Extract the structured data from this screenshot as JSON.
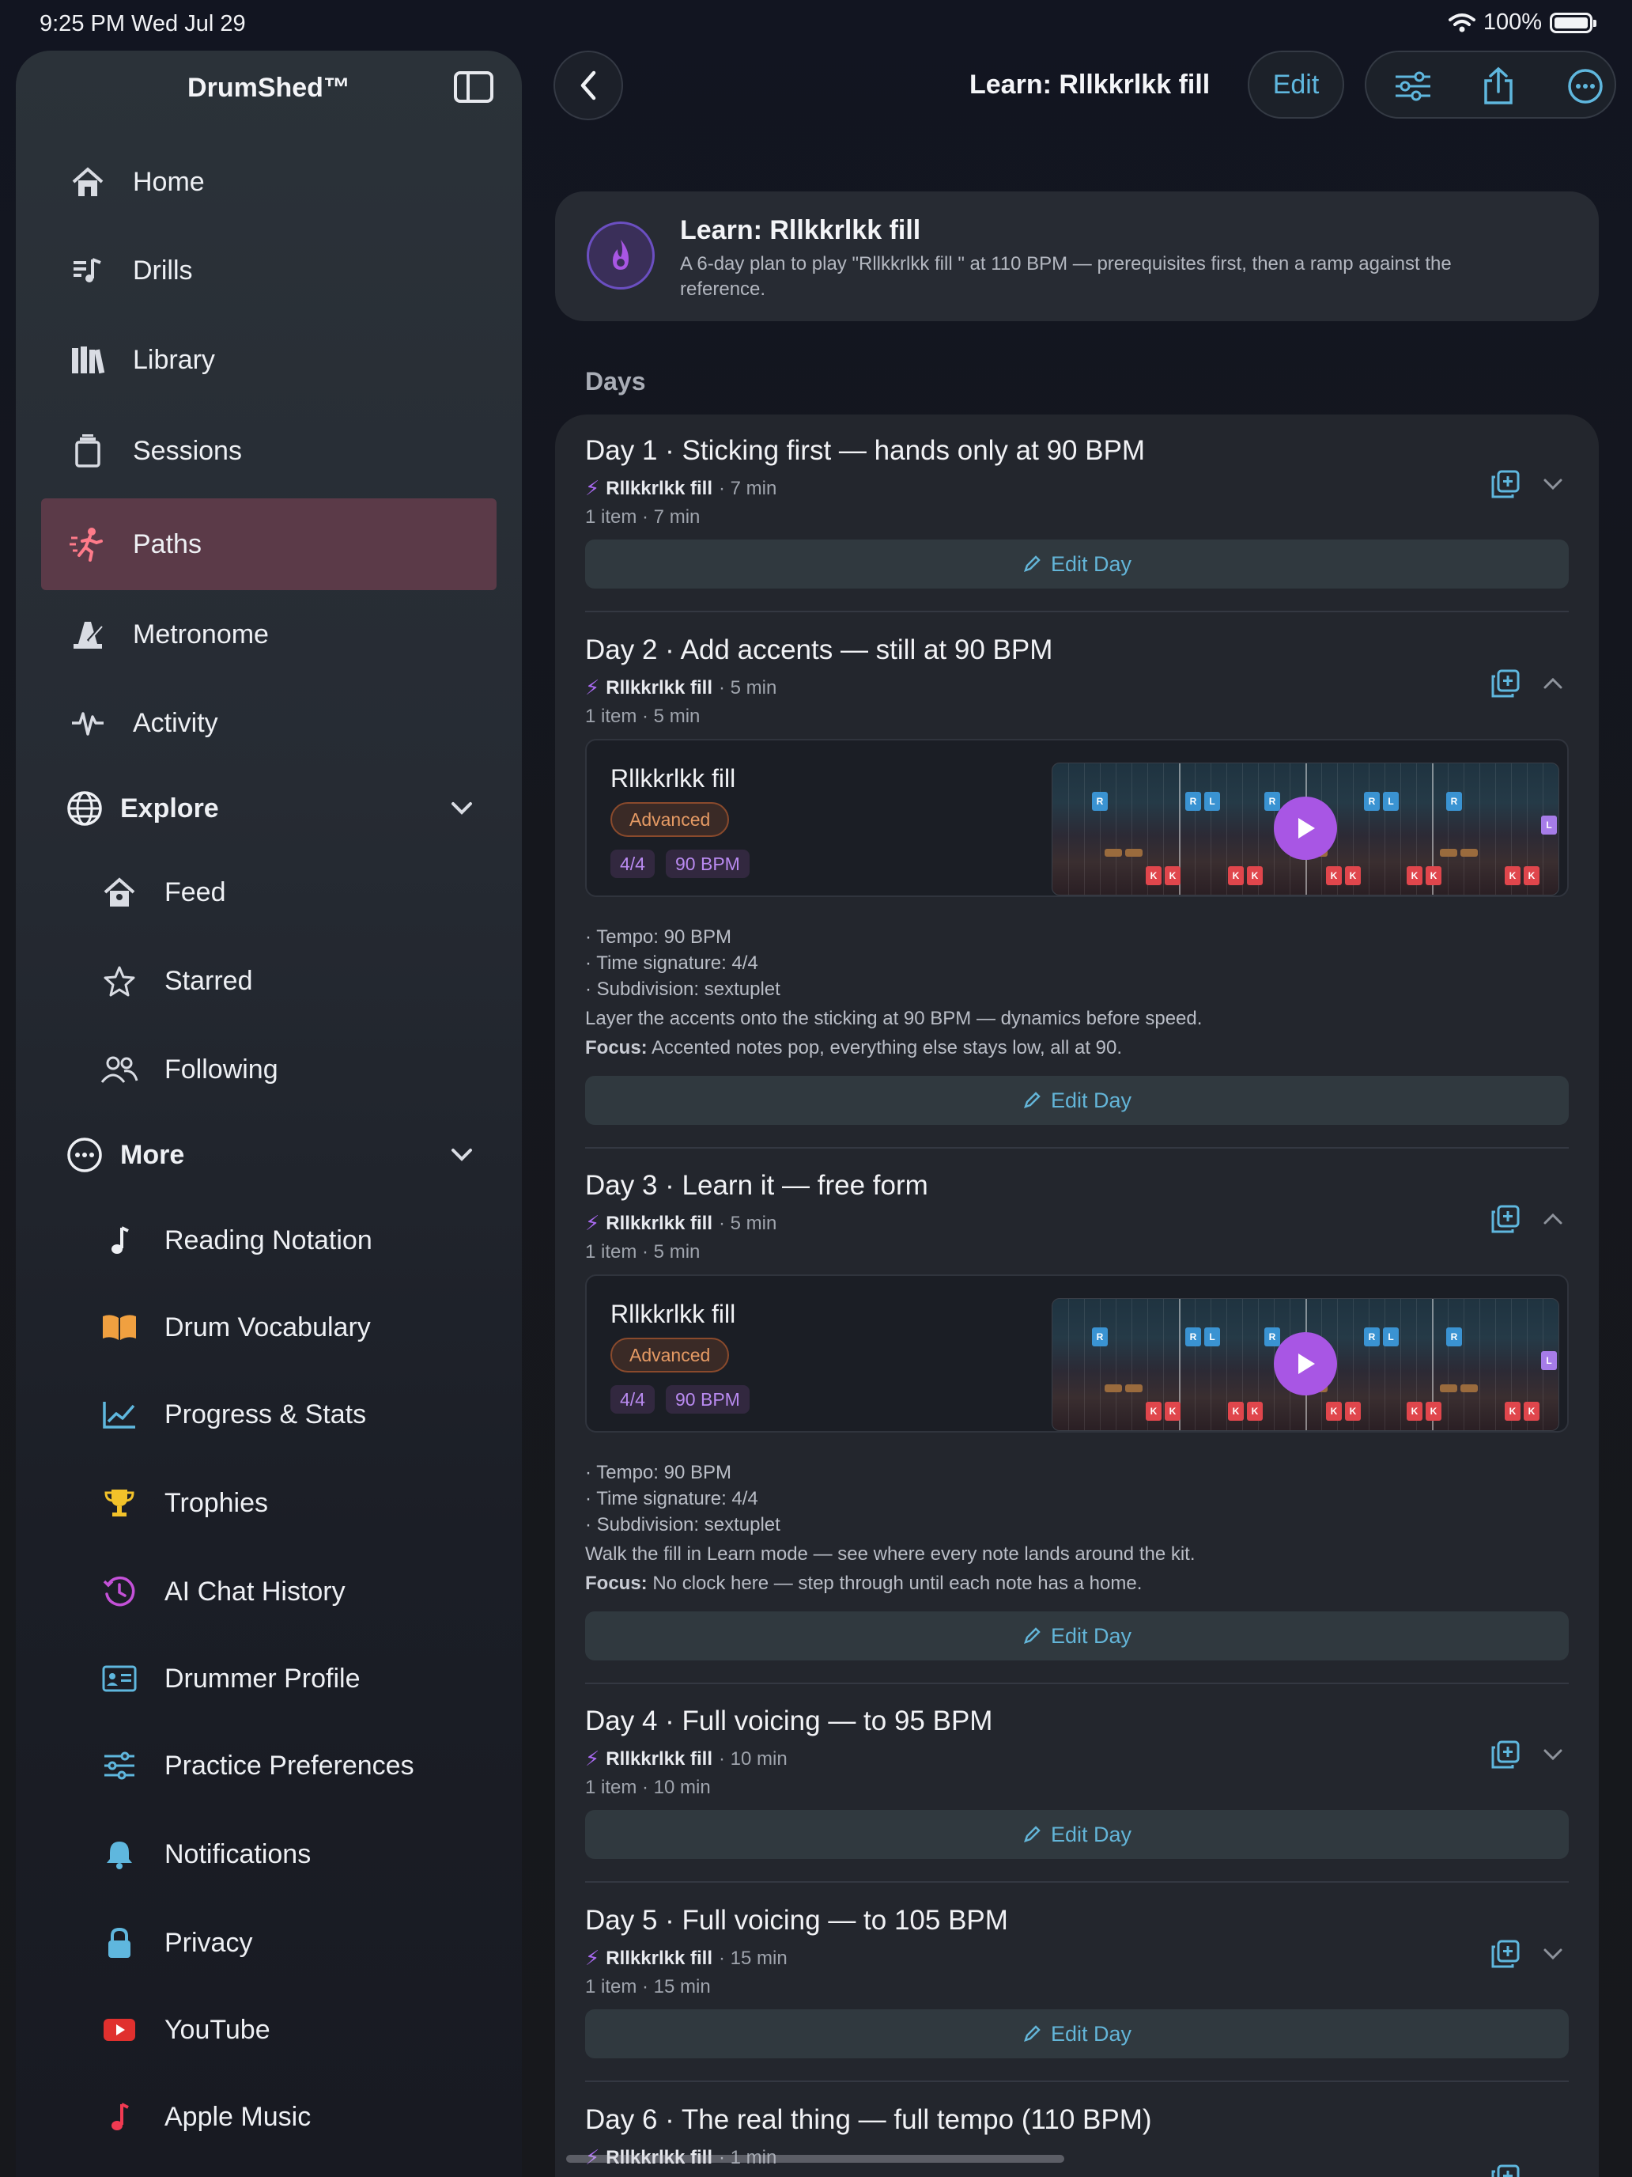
{
  "status_bar": {
    "time": "9:25 PM  Wed Jul 29",
    "battery": "100%"
  },
  "sidebar": {
    "title": "DrumShed™",
    "items": [
      {
        "label": "Home",
        "icon": "house-icon"
      },
      {
        "label": "Drills",
        "icon": "drills-icon"
      },
      {
        "label": "Library",
        "icon": "books-icon"
      },
      {
        "label": "Sessions",
        "icon": "sessions-icon"
      },
      {
        "label": "Paths",
        "icon": "running-figure-icon",
        "active": true
      },
      {
        "label": "Metronome",
        "icon": "metronome-icon"
      },
      {
        "label": "Activity",
        "icon": "waveform-icon"
      }
    ],
    "explore": {
      "label": "Explore",
      "items": [
        {
          "label": "Feed",
          "icon": "house-person-icon"
        },
        {
          "label": "Starred",
          "icon": "star-icon"
        },
        {
          "label": "Following",
          "icon": "people-icon"
        }
      ]
    },
    "more": {
      "label": "More",
      "items": [
        {
          "label": "Reading Notation",
          "icon": "music-note-icon"
        },
        {
          "label": "Drum Vocabulary",
          "icon": "book-icon"
        },
        {
          "label": "Progress & Stats",
          "icon": "chart-icon"
        },
        {
          "label": "Trophies",
          "icon": "trophy-icon"
        },
        {
          "label": "AI Chat History",
          "icon": "history-icon"
        },
        {
          "label": "Drummer Profile",
          "icon": "id-card-icon"
        },
        {
          "label": "Practice Preferences",
          "icon": "sliders-icon"
        },
        {
          "label": "Notifications",
          "icon": "bell-icon"
        },
        {
          "label": "Privacy",
          "icon": "lock-icon"
        },
        {
          "label": "YouTube",
          "icon": "youtube-icon"
        },
        {
          "label": "Apple Music",
          "icon": "apple-music-icon"
        }
      ]
    }
  },
  "header": {
    "title": "Learn: Rllkkrlkk fill",
    "edit_label": "Edit"
  },
  "plan": {
    "title": "Learn: Rllkkrlkk fill",
    "description": "A 6-day plan to play \"Rllkkrlkk fill \" at 110 BPM — prerequisites first, then a ramp against the reference."
  },
  "days_heading": "Days",
  "edit_day_label": "Edit Day",
  "days": [
    {
      "title": "Day 1 · Sticking first — hands only at 90 BPM",
      "item_name": "Rllkkrlkk fill",
      "item_time": "· 7 min",
      "count": "1 item · 7 min"
    },
    {
      "title": "Day 2 · Add accents — still at 90 BPM",
      "item_name": "Rllkkrlkk fill",
      "item_time": "· 5 min",
      "count": "1 item · 5 min",
      "preview": {
        "name": "Rllkkrlkk fill",
        "level": "Advanced",
        "time_sig": "4/4",
        "bpm": "90 BPM"
      },
      "tempo": "· Tempo: 90 BPM",
      "time_signature": "· Time signature: 4/4",
      "subdivision": "· Subdivision: sextuplet",
      "description": "Layer the accents onto the sticking at 90 BPM — dynamics before speed.",
      "focus_label": "Focus:",
      "focus": "Accented notes pop, everything else stays low, all at 90."
    },
    {
      "title": "Day 3 · Learn it — free form",
      "item_name": "Rllkkrlkk fill",
      "item_time": "· 5 min",
      "count": "1 item · 5 min",
      "preview": {
        "name": "Rllkkrlkk fill",
        "level": "Advanced",
        "time_sig": "4/4",
        "bpm": "90 BPM"
      },
      "tempo": "· Tempo: 90 BPM",
      "time_signature": "· Time signature: 4/4",
      "subdivision": "· Subdivision: sextuplet",
      "description": "Walk the fill in Learn mode — see where every note lands around the kit.",
      "focus_label": "Focus:",
      "focus": "No clock here — step through until each note has a home."
    },
    {
      "title": "Day 4 · Full voicing — to 95 BPM",
      "item_name": "Rllkkrlkk fill",
      "item_time": "· 10 min",
      "count": "1 item · 10 min"
    },
    {
      "title": "Day 5 · Full voicing — to 105 BPM",
      "item_name": "Rllkkrlkk fill",
      "item_time": "· 15 min",
      "count": "1 item · 15 min"
    },
    {
      "title": "Day 6 · The real thing — full tempo (110 BPM)",
      "item_name": "Rllkkrlkk fill",
      "item_time": "· 1 min"
    }
  ],
  "note_labels": {
    "right": "R",
    "left": "L",
    "kick": "K"
  },
  "colors": {
    "accent": "#5fb7de",
    "active_nav": "#5b3a48",
    "purple": "#a856e4",
    "advanced": "#e59a64"
  }
}
